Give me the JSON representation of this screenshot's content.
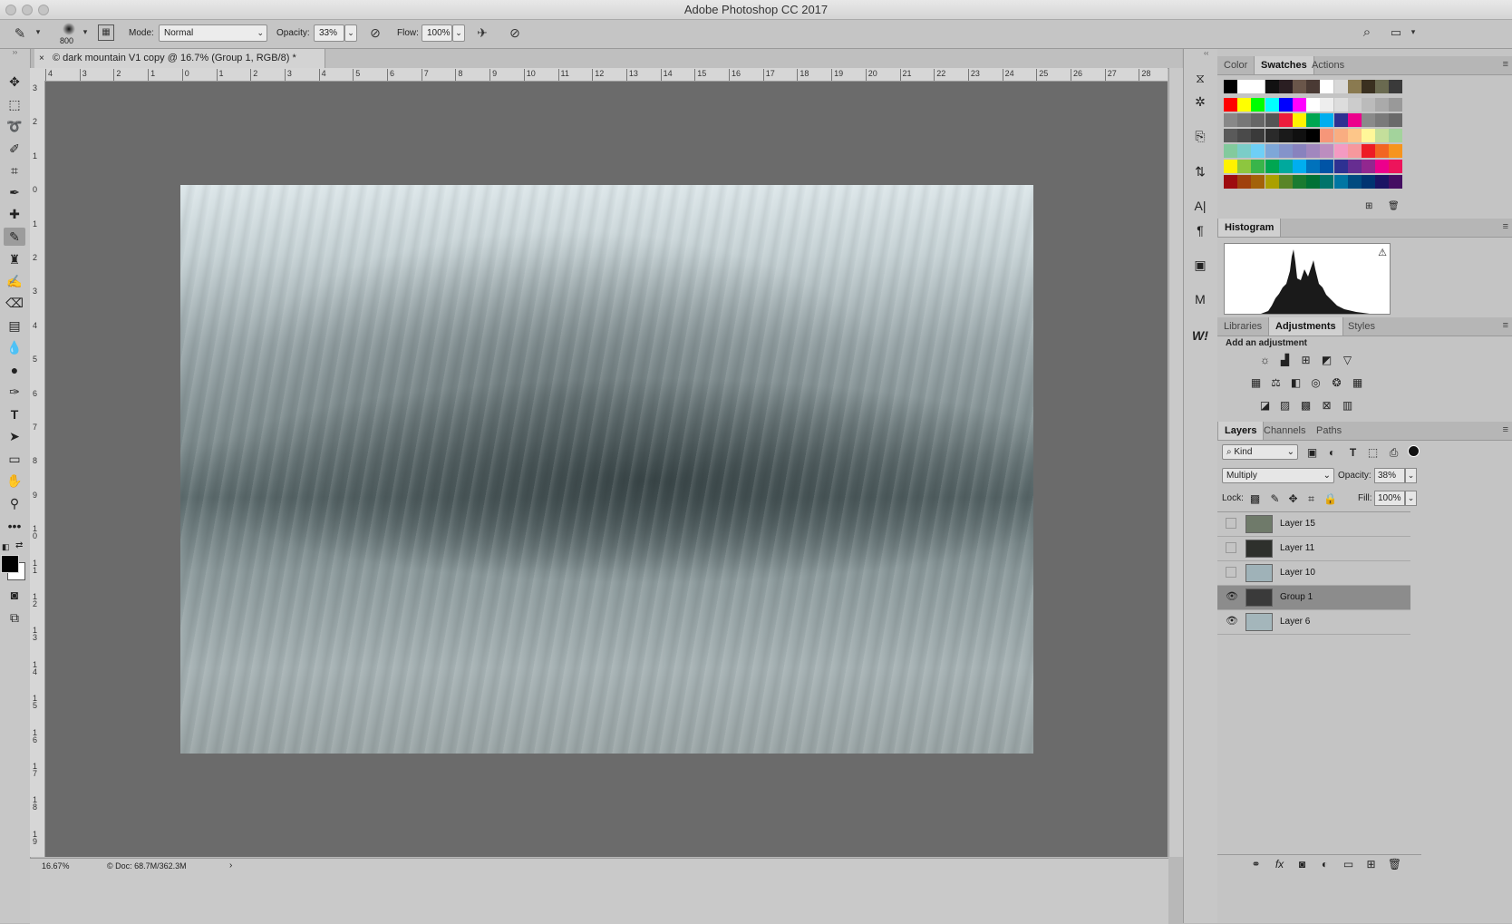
{
  "app": {
    "title": "Adobe Photoshop CC 2017"
  },
  "options_bar": {
    "brush_size": "800",
    "mode_label": "Mode:",
    "mode_value": "Normal",
    "opacity_label": "Opacity:",
    "opacity_value": "33%",
    "flow_label": "Flow:",
    "flow_value": "100%"
  },
  "document": {
    "tab_title": "© dark mountain V1 copy @ 16.7% (Group 1, RGB/8) *",
    "close_glyph": "×"
  },
  "rulers": {
    "horizontal": [
      "4",
      "3",
      "2",
      "1",
      "0",
      "1",
      "2",
      "3",
      "4",
      "5",
      "6",
      "7",
      "8",
      "9",
      "10",
      "11",
      "12",
      "13",
      "14",
      "15",
      "16",
      "17",
      "18",
      "19",
      "20",
      "21",
      "22",
      "23",
      "24",
      "25",
      "26",
      "27",
      "28"
    ],
    "vertical": [
      "3",
      "2",
      "1",
      "0",
      "1",
      "2",
      "3",
      "4",
      "5",
      "6",
      "7",
      "8",
      "9",
      "1 0",
      "1 1",
      "1 2",
      "1 3",
      "1 4",
      "1 5",
      "1 6",
      "1 7",
      "1 8",
      "1 9"
    ]
  },
  "status": {
    "zoom": "16.67%",
    "doc_info": "Doc: 68.7M/362.3M"
  },
  "panels": {
    "color_tabs": [
      "Color",
      "Swatches",
      "Actions"
    ],
    "active_color_tab": "Swatches",
    "swatch_colors_row1": [
      "#000000",
      "#ffffff",
      "#ffffff",
      "#111111",
      "#2a1e22",
      "#6a564a",
      "#4a3a34",
      "#ffffff",
      "#d8d8d8",
      "#8a7a50",
      "#3a3020",
      "#6a6a50",
      "#3a3a3a"
    ],
    "histogram_title": "Histogram",
    "histogram_warning": "⚠",
    "adj_tabs": [
      "Libraries",
      "Adjustments",
      "Styles"
    ],
    "active_adj_tab": "Adjustments",
    "add_adjustment": "Add an adjustment",
    "layer_tabs": [
      "Layers",
      "Channels",
      "Paths"
    ],
    "active_layer_tab": "Layers",
    "kind_label": "Kind",
    "blend_mode": "Multiply",
    "opacity_label": "Opacity:",
    "opacity_value": "38%",
    "lock_label": "Lock:",
    "fill_label": "Fill:",
    "fill_value": "100%",
    "layers": [
      {
        "name": "Layer 15",
        "visible": false,
        "selected": false,
        "thumb": "#6f7a6a"
      },
      {
        "name": "Layer 11",
        "visible": false,
        "selected": false,
        "thumb": "#2e302c"
      },
      {
        "name": "Layer 10",
        "visible": false,
        "selected": false,
        "thumb": "#9fb2b8"
      },
      {
        "name": "Group 1",
        "visible": true,
        "selected": true,
        "thumb": "#3a3a3a"
      },
      {
        "name": "Layer 6",
        "visible": true,
        "selected": false,
        "thumb": "#a4b6bb"
      }
    ]
  }
}
